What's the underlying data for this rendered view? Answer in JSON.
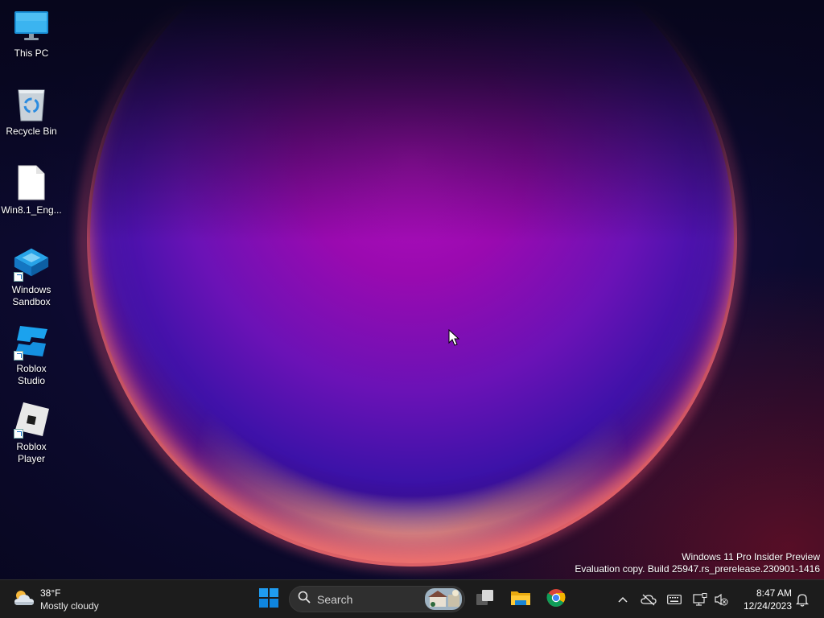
{
  "desktop": {
    "icons": [
      {
        "label": "This PC",
        "icon": "monitor-icon"
      },
      {
        "label": "Recycle Bin",
        "icon": "recycle-bin-icon"
      },
      {
        "label": "Win8.1_Eng...",
        "icon": "file-icon"
      },
      {
        "label": "Windows Sandbox",
        "icon": "sandbox-icon",
        "shortcut": true
      },
      {
        "label": "Roblox Studio",
        "icon": "roblox-studio-icon",
        "shortcut": true
      },
      {
        "label": "Roblox Player",
        "icon": "roblox-player-icon",
        "shortcut": true
      }
    ]
  },
  "watermark": {
    "line1": "Windows 11 Pro Insider Preview",
    "line2": "Evaluation copy. Build 25947.rs_prerelease.230901-1416"
  },
  "taskbar": {
    "weather": {
      "temperature": "38°F",
      "condition": "Mostly cloudy",
      "icon": "cloud-sun-icon"
    },
    "start_icon": "windows-logo-icon",
    "search": {
      "placeholder": "Search",
      "icon": "search-icon"
    },
    "pinned": [
      {
        "name": "Task View",
        "icon": "task-view-icon"
      },
      {
        "name": "File Explorer",
        "icon": "folder-icon"
      },
      {
        "name": "Google Chrome",
        "icon": "chrome-icon"
      }
    ],
    "tray": {
      "icons": [
        "chevron-up-icon",
        "cloud-off-icon",
        "keyboard-icon",
        "network-icon",
        "volume-muted-icon",
        "notification-bell-icon"
      ]
    },
    "clock": {
      "time": "8:47 AM",
      "date": "12/24/2023"
    }
  },
  "colors": {
    "taskbar_bg": "#1c1c1c",
    "accent_blue": "#0a84ff",
    "orb_magenta": "#b30fbf"
  }
}
